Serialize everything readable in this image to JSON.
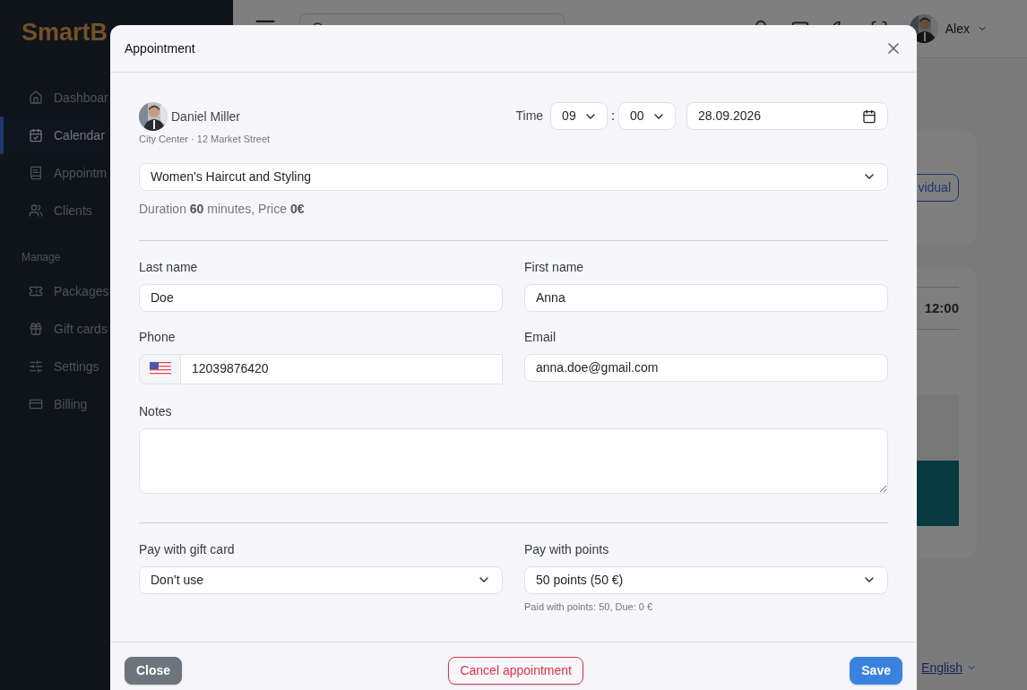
{
  "sidebar": {
    "logo": "SmartB",
    "items": [
      {
        "label": "Dashboar",
        "selected": false
      },
      {
        "label": "Calendar",
        "selected": true
      },
      {
        "label": "Appointm",
        "selected": false
      },
      {
        "label": "Clients",
        "selected": false
      }
    ],
    "section": "Manage",
    "manage_items": [
      {
        "label": "Packages",
        "selected": false
      },
      {
        "label": "Gift cards",
        "selected": false
      },
      {
        "label": "Settings",
        "selected": false
      },
      {
        "label": "Billing",
        "selected": false
      }
    ]
  },
  "header": {
    "user": "Alex"
  },
  "background": {
    "button": "vidual",
    "time": "12:00",
    "link": "English"
  },
  "modal": {
    "title": "Appointment",
    "staff": {
      "name": "Daniel Miller",
      "location": "City Center · 12 Market Street"
    },
    "time_label": "Time",
    "hour": "09",
    "separator": ":",
    "minute": "00",
    "date": "28.09.2026",
    "service": "Women's Haircut and Styling",
    "summary": "Duration **60** minutes, Price **0€**",
    "last_name": {
      "label": "Last name",
      "value": "Doe"
    },
    "first_name": {
      "label": "First name",
      "value": "Anna"
    },
    "phone": {
      "label": "Phone",
      "value": "12039876420"
    },
    "email": {
      "label": "Email",
      "value": "anna.doe@gmail.com"
    },
    "notes": {
      "label": "Notes"
    },
    "gift_card": {
      "label": "Pay with gift card",
      "value": "Don’t use"
    },
    "points": {
      "label": "Pay with points",
      "value": "50 points (50 €)",
      "note": "Paid with points: 50, Due: 0 €"
    },
    "buttons": [
      {
        "label": "Close",
        "kind": "secondary"
      },
      {
        "label": "Cancel appointment",
        "kind": "danger"
      },
      {
        "label": "Save",
        "kind": "primary"
      }
    ]
  }
}
